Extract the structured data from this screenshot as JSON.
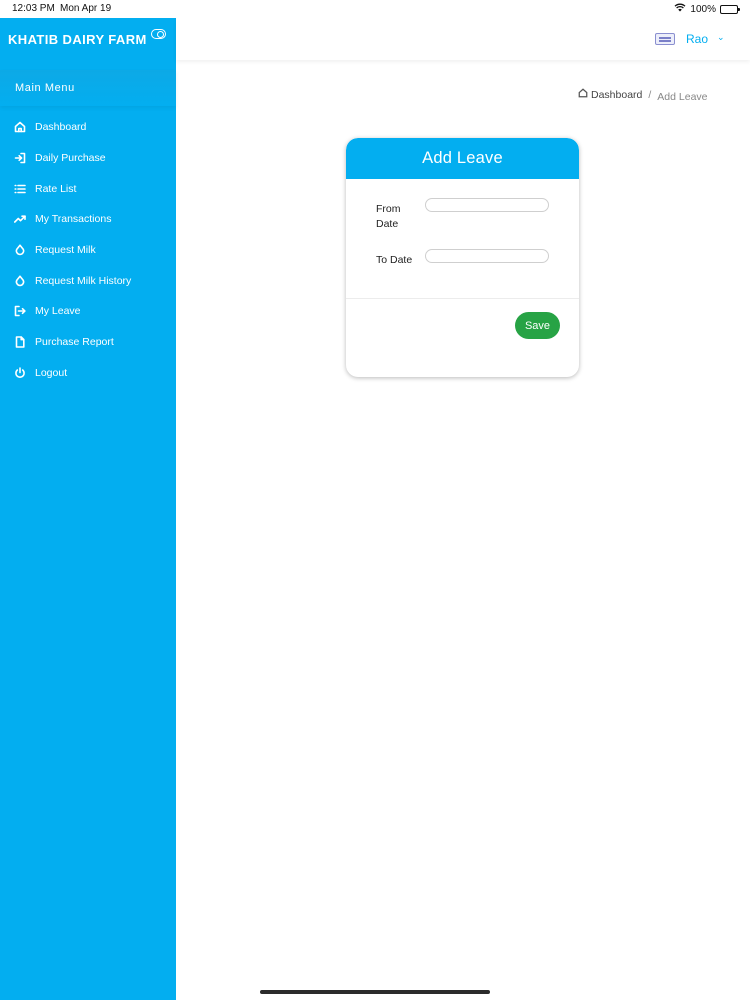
{
  "status_bar": {
    "time": "12:03 PM",
    "date": "Mon Apr 19",
    "battery_text": "100%",
    "battery_level": 1.0
  },
  "sidebar": {
    "brand": "KHATIB DAIRY FARM",
    "menu_header": "Main Menu",
    "items": [
      {
        "label": "Dashboard",
        "icon": "home-icon"
      },
      {
        "label": "Daily Purchase",
        "icon": "login-icon"
      },
      {
        "label": "Rate List",
        "icon": "list-icon"
      },
      {
        "label": "My Transactions",
        "icon": "trending-up-icon"
      },
      {
        "label": "Request Milk",
        "icon": "droplet-icon"
      },
      {
        "label": "Request Milk History",
        "icon": "droplet-icon"
      },
      {
        "label": "My Leave",
        "icon": "logout-icon"
      },
      {
        "label": "Purchase Report",
        "icon": "file-icon"
      },
      {
        "label": "Logout",
        "icon": "power-icon"
      }
    ]
  },
  "topbar": {
    "user_name": "Rao",
    "user_chevron": "⌄"
  },
  "breadcrumb": {
    "home": "Dashboard",
    "separator": "/",
    "current": "Add Leave"
  },
  "form": {
    "title": "Add Leave",
    "from_label": "From Date",
    "from_value": "",
    "to_label": "To Date",
    "to_value": "",
    "save_label": "Save"
  },
  "colors": {
    "accent": "#03aef0",
    "save_button": "#27a345"
  }
}
